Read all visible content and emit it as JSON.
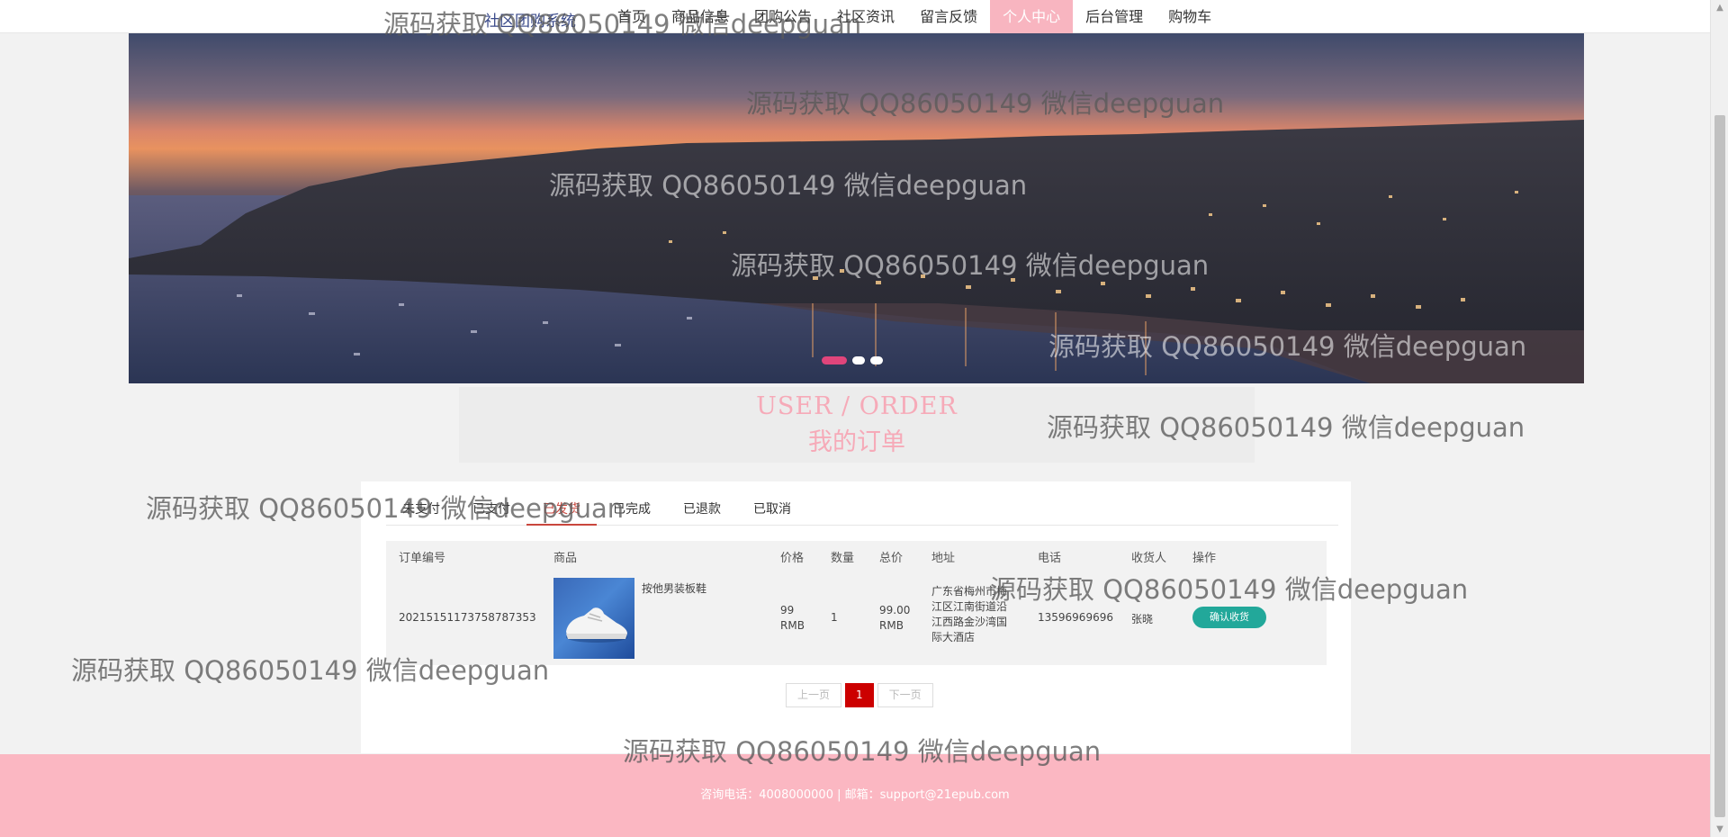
{
  "nav": {
    "brand": "社区团购系统",
    "items": [
      "首页",
      "商品信息",
      "团购公告",
      "社区资讯",
      "留言反馈",
      "个人中心",
      "后台管理",
      "购物车"
    ],
    "active_index": 5
  },
  "banner": {
    "dot_count": 3,
    "active_dot": 0
  },
  "section": {
    "title_en": "USER / ORDER",
    "title_zh": "我的订单"
  },
  "tabs": {
    "items": [
      "未支付",
      "已支付",
      "已发货",
      "已完成",
      "已退款",
      "已取消"
    ],
    "active_index": 2
  },
  "table": {
    "headers": {
      "order_no": "订单编号",
      "product": "商品",
      "price": "价格",
      "qty": "数量",
      "total": "总价",
      "address": "地址",
      "phone": "电话",
      "receiver": "收货人",
      "action": "操作"
    },
    "rows": [
      {
        "order_no": "20215151173758787353",
        "product_name": "按他男装板鞋",
        "price": "99",
        "price_unit": "RMB",
        "qty": "1",
        "total": "99.00",
        "total_unit": "RMB",
        "address": "广东省梅州市梅江区江南街道沿江西路金沙湾国际大酒店",
        "phone": "13596969696",
        "receiver": "张晓",
        "action_label": "确认收货"
      }
    ]
  },
  "pagination": {
    "prev": "上一页",
    "current": "1",
    "next": "下一页"
  },
  "footer": {
    "text": "咨询电话：4008000000 | 邮箱：support@21epub.com"
  },
  "watermark": {
    "text": "源码获取 QQ86050149 微信deepguan"
  },
  "colors": {
    "nav_active": "#f8b5c0",
    "footer_bg": "#fbb7c2",
    "tab_active": "#c9463d",
    "confirm_button": "#22a89a",
    "current_page": "#cc0000",
    "dot_active": "#e0457b"
  }
}
